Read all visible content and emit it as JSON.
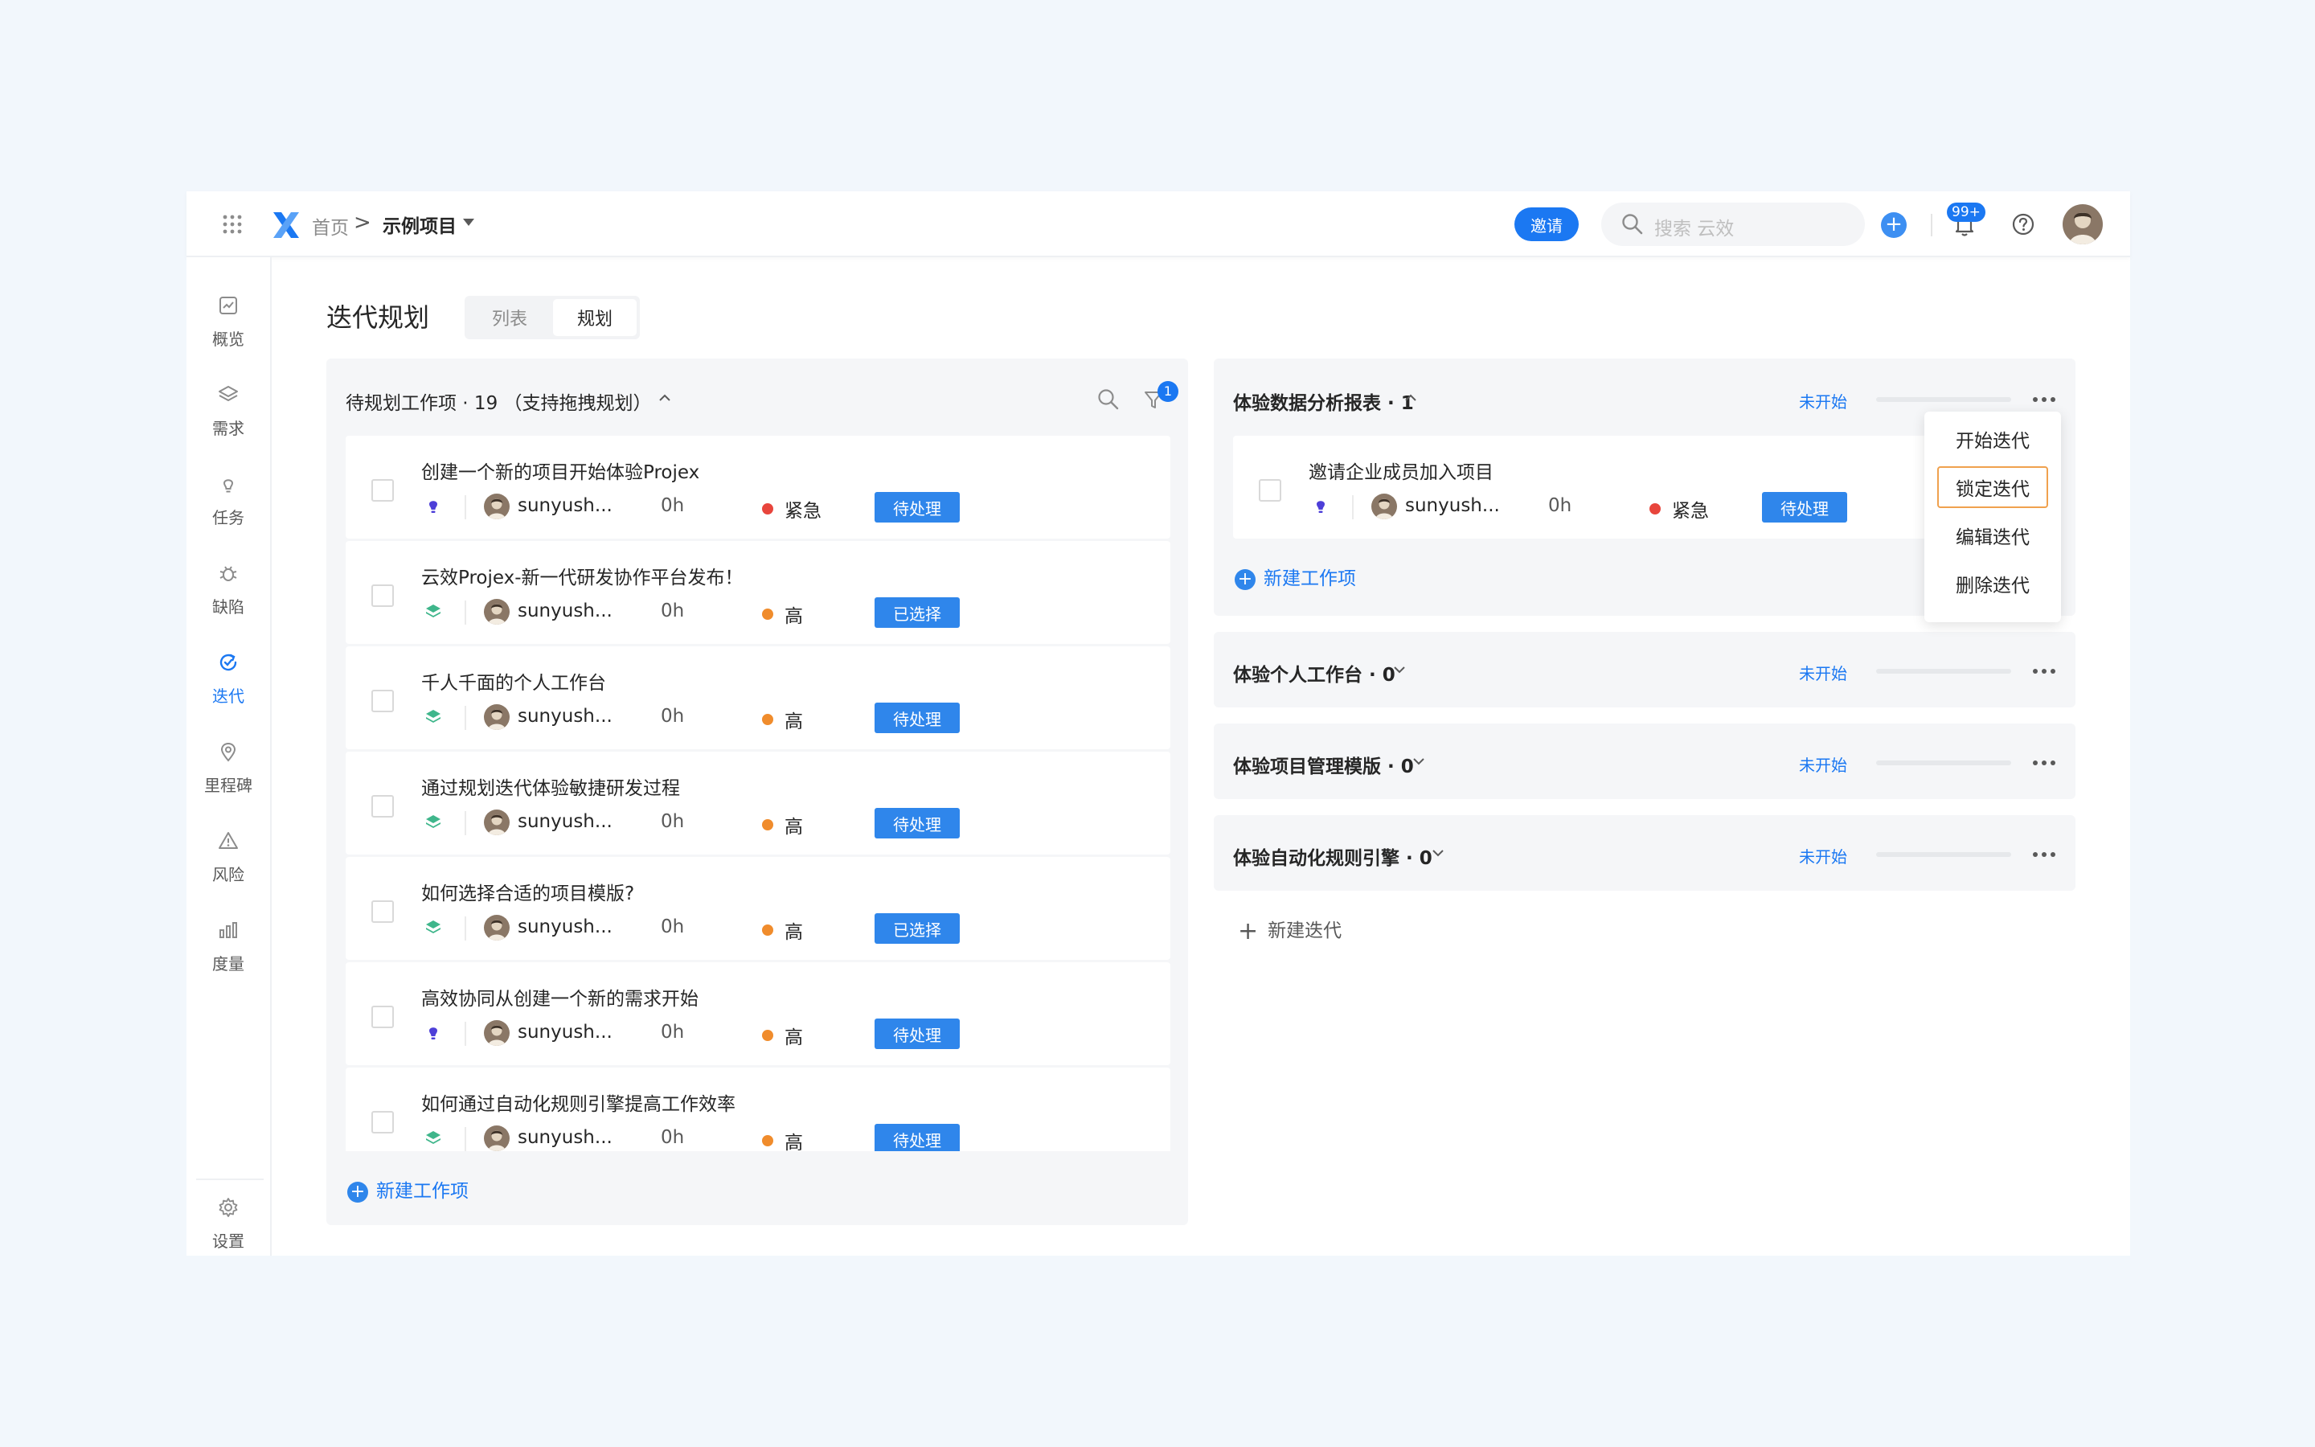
{
  "header": {
    "breadcrumb_home": "首页",
    "breadcrumb_sep": ">",
    "project_name": "示例项目",
    "invite_label": "邀请",
    "search_placeholder": "搜索 云效",
    "notification_count": "99+",
    "accent_color": "#1b78f2"
  },
  "sidebar": {
    "items": [
      {
        "label": "概览",
        "icon": "overview-icon"
      },
      {
        "label": "需求",
        "icon": "layers-icon"
      },
      {
        "label": "任务",
        "icon": "bulb-icon"
      },
      {
        "label": "缺陷",
        "icon": "bug-icon"
      },
      {
        "label": "迭代",
        "icon": "iteration-icon",
        "active": true
      },
      {
        "label": "里程碑",
        "icon": "location-pin-icon"
      },
      {
        "label": "风险",
        "icon": "warning-icon"
      },
      {
        "label": "度量",
        "icon": "bar-chart-icon"
      }
    ],
    "settings_label": "设置"
  },
  "page": {
    "title": "迭代规划",
    "view_tabs": [
      "列表",
      "规划"
    ],
    "active_view": "规划"
  },
  "backlog": {
    "title": "待规划工作项 · 19 （支持拖拽规划）",
    "filter_count": "1",
    "new_item_label": "新建工作项",
    "items": [
      {
        "title": "创建一个新的项目开始体验Projex",
        "type": "task",
        "assignee": "sunyush...",
        "hours": "0h",
        "priority": "紧急",
        "priority_color": "#e8453c",
        "status": "待处理"
      },
      {
        "title": "云效Projex-新一代研发协作平台发布！",
        "type": "requirement",
        "assignee": "sunyush...",
        "hours": "0h",
        "priority": "高",
        "priority_color": "#f08c2c",
        "status": "已选择"
      },
      {
        "title": "千人千面的个人工作台",
        "type": "requirement",
        "assignee": "sunyush...",
        "hours": "0h",
        "priority": "高",
        "priority_color": "#f08c2c",
        "status": "待处理"
      },
      {
        "title": "通过规划迭代体验敏捷研发过程",
        "type": "requirement",
        "assignee": "sunyush...",
        "hours": "0h",
        "priority": "高",
        "priority_color": "#f08c2c",
        "status": "待处理"
      },
      {
        "title": "如何选择合适的项目模版?",
        "type": "requirement",
        "assignee": "sunyush...",
        "hours": "0h",
        "priority": "高",
        "priority_color": "#f08c2c",
        "status": "已选择"
      },
      {
        "title": "高效协同从创建一个新的需求开始",
        "type": "task",
        "assignee": "sunyush...",
        "hours": "0h",
        "priority": "高",
        "priority_color": "#f08c2c",
        "status": "待处理"
      },
      {
        "title": "如何通过自动化规则引擎提高工作效率",
        "type": "requirement",
        "assignee": "sunyush...",
        "hours": "0h",
        "priority": "高",
        "priority_color": "#f08c2c",
        "status": "待处理"
      }
    ]
  },
  "sprints": [
    {
      "title": "体验数据分析报表 · 1",
      "expanded": true,
      "status": "未开始",
      "progress": 0,
      "new_item_label": "新建工作项",
      "items": [
        {
          "title": "邀请企业成员加入项目",
          "type": "task",
          "assignee": "sunyush...",
          "hours": "0h",
          "priority": "紧急",
          "priority_color": "#e8453c",
          "status": "待处理"
        }
      ]
    },
    {
      "title": "体验个人工作台 · 0",
      "expanded": false,
      "status": "未开始",
      "progress": 0
    },
    {
      "title": "体验项目管理模版 · 0",
      "expanded": false,
      "status": "未开始",
      "progress": 0
    },
    {
      "title": "体验自动化规则引擎 · 0",
      "expanded": false,
      "status": "未开始",
      "progress": 0
    }
  ],
  "new_sprint_label": "新建迭代",
  "sprint_menu": {
    "items": [
      "开始迭代",
      "锁定迭代",
      "编辑迭代",
      "删除迭代"
    ],
    "highlighted": "锁定迭代"
  }
}
